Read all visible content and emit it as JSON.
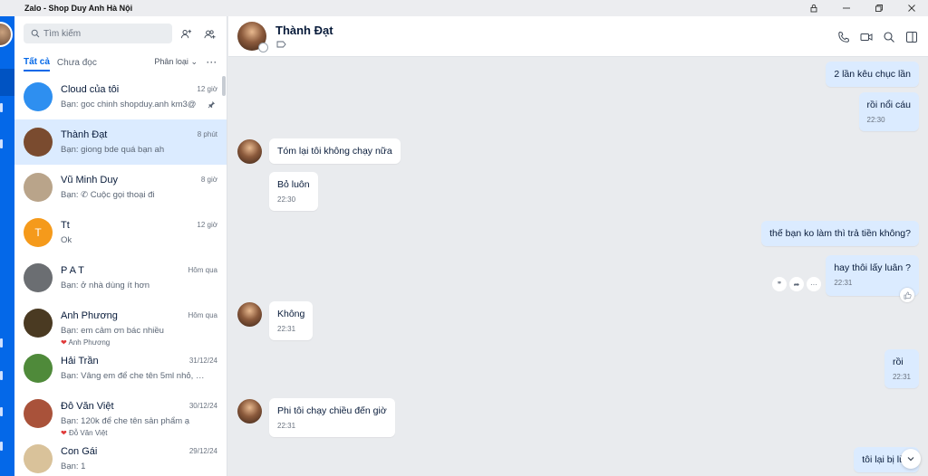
{
  "window": {
    "title": "Zalo - Shop Duy Anh Hà Nội"
  },
  "colors": {
    "accent": "#0468e8",
    "active_row": "#dbebff",
    "out_bubble": "#dbebff"
  },
  "search": {
    "placeholder": "Tìm kiếm"
  },
  "tabs": {
    "all": "Tất cả",
    "unread": "Chưa đọc",
    "classify": "Phân loại",
    "more": "···"
  },
  "conversations": [
    {
      "name": "Cloud của tôi",
      "time": "12 giờ",
      "preview": "Bạn: goc chinh shopduy.anh km3@",
      "avatar_text": "",
      "avatar_color": "#2e8ff0",
      "pinned": true
    },
    {
      "name": "Thành Đạt",
      "time": "8 phút",
      "preview": "Bạn: giong bde quá bạn ah",
      "avatar_text": "",
      "avatar_color": "#7a4b2f",
      "active": true
    },
    {
      "name": "Vũ Minh Duy",
      "time": "8 giờ",
      "preview": "Bạn: ✆ Cuộc gọi thoại đi",
      "avatar_text": "",
      "avatar_color": "#b9a48a"
    },
    {
      "name": "Tt",
      "time": "12 giờ",
      "preview": "Ok",
      "avatar_text": "T",
      "avatar_color": "#f59a1b"
    },
    {
      "name": "P A T",
      "time": "Hôm qua",
      "preview": "Bạn: ở nhà dùng ít hơn",
      "avatar_text": "",
      "avatar_color": "#6b6e72"
    },
    {
      "name": "Anh Phương",
      "time": "Hôm qua",
      "preview": "Bạn: em cảm ơn bác nhiều",
      "reaction": "Anh Phương",
      "avatar_text": "",
      "avatar_color": "#4a3a22"
    },
    {
      "name": "Hải Trần",
      "time": "31/12/24",
      "preview": "Bạn: Vâng em để che tên 5ml nhỏ, đơ...",
      "avatar_text": "",
      "avatar_color": "#4f8a3a"
    },
    {
      "name": "Đỗ Văn Việt",
      "time": "30/12/24",
      "preview": "Bạn: 120k để che tên sản phẩm ạ",
      "reaction": "Đỗ Văn Việt",
      "avatar_text": "",
      "avatar_color": "#a9523a"
    },
    {
      "name": "Con Gái",
      "time": "29/12/24",
      "preview": "Bạn: 1",
      "avatar_text": "",
      "avatar_color": "#d9c29a"
    }
  ],
  "chat": {
    "contact_name": "Thành Đạt",
    "messages": [
      {
        "dir": "out",
        "text": "2 lần kêu chục lần",
        "time": ""
      },
      {
        "dir": "out",
        "text": "rồi nổi cáu",
        "time": "22:30"
      },
      {
        "dir": "in",
        "text": "Tóm lại tôi không chạy nữa",
        "time": ""
      },
      {
        "dir": "in",
        "text": "Bỏ luôn",
        "time": "22:30"
      },
      {
        "dir": "out",
        "text": "thế bạn ko làm thì trả tiền không?",
        "time": ""
      },
      {
        "dir": "out",
        "text": "hay thôi lấy luân ?",
        "time": "22:31"
      },
      {
        "dir": "in",
        "text": "Không",
        "time": "22:31"
      },
      {
        "dir": "out",
        "text": "rồi",
        "time": "22:31"
      },
      {
        "dir": "in",
        "text": "Phi tôi chạy chiều đến giờ",
        "time": "22:31"
      },
      {
        "dir": "out",
        "text": "tôi lại bị lừa",
        "time": ""
      }
    ]
  }
}
